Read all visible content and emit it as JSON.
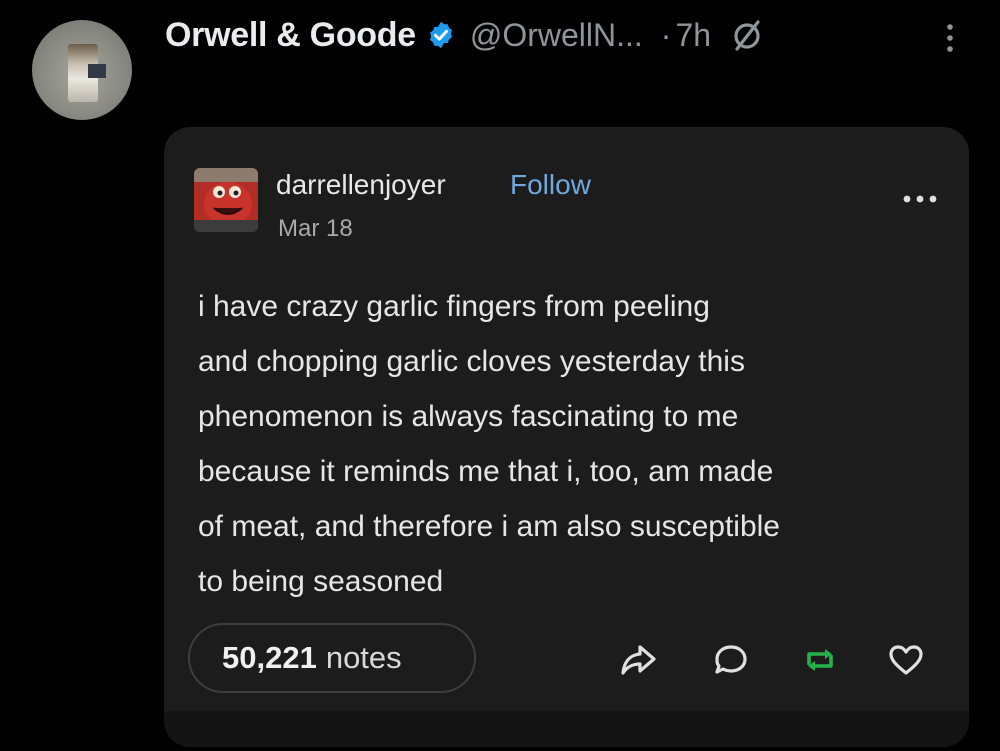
{
  "tweet": {
    "display_name": "Orwell & Goode",
    "handle": "@OrwellN...",
    "separator": "·",
    "time": "7h",
    "verified_color": "#1d9bf0"
  },
  "embedded_post": {
    "username": "darrellenjoyer",
    "follow_label": "Follow",
    "date": "Mar 18",
    "body_lines": [
      "i have crazy garlic fingers from peeling",
      "and chopping garlic cloves yesterday this",
      "phenomenon is always fascinating to me",
      "because it reminds me that i, too, am made",
      "of meat, and therefore i am also susceptible",
      "to being seasoned"
    ],
    "notes_count": "50,221",
    "notes_label": "notes",
    "accent_follow": "#6fa8dc",
    "reblog_color": "#26b24b"
  },
  "icons": {
    "verified": "verified-badge-icon",
    "muted": "muted-circle-slash-icon",
    "more": "vertical-ellipsis-icon",
    "card_more": "horizontal-ellipsis-icon",
    "share": "share-arrow-icon",
    "reply": "speech-bubble-icon",
    "reblog": "reblog-arrows-icon",
    "like": "heart-outline-icon"
  }
}
